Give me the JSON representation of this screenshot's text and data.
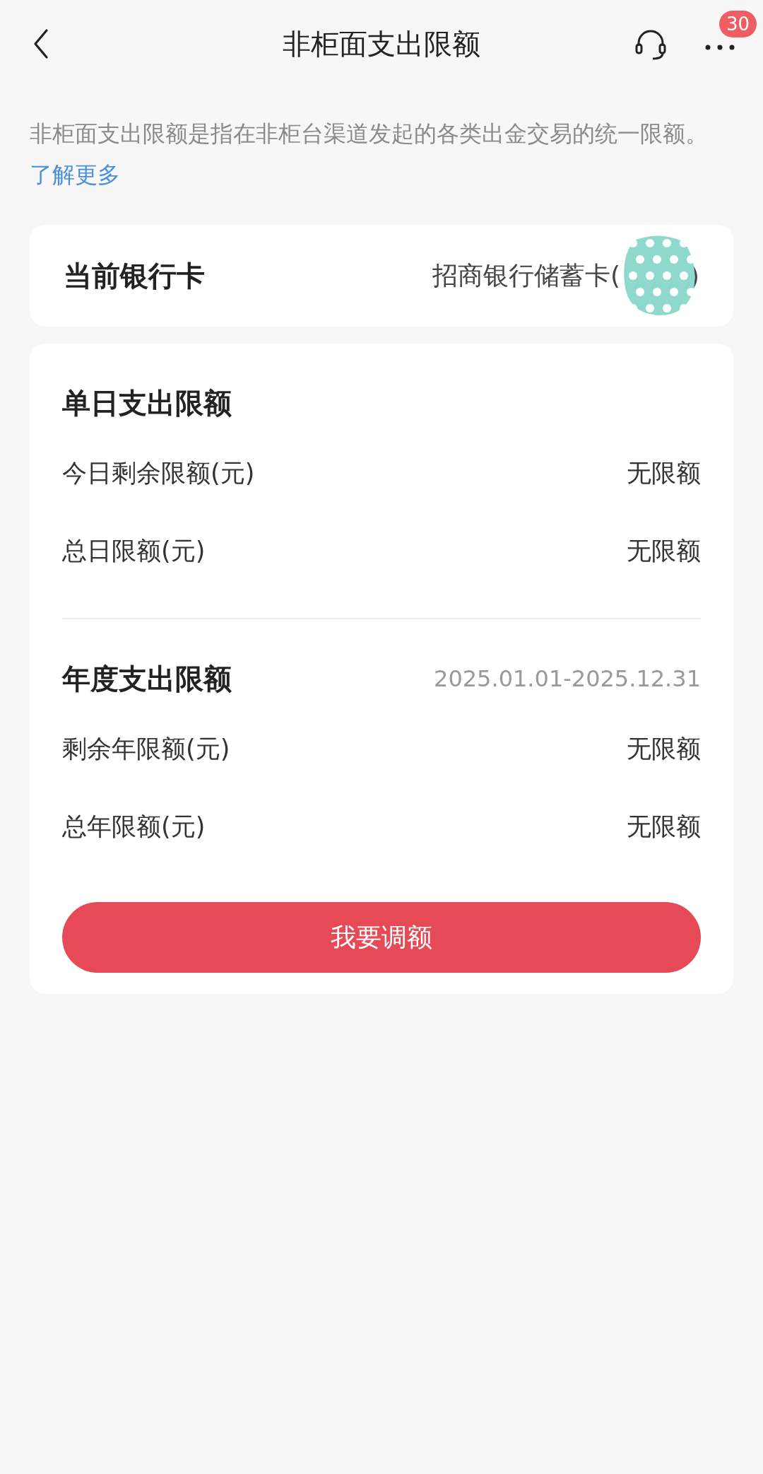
{
  "nav": {
    "title": "非柜面支出限额",
    "badge": "30"
  },
  "intro": {
    "text": "非柜面支出限额是指在非柜台渠道发起的各类出金交易的统一限额。",
    "link": "了解更多"
  },
  "card": {
    "label": "当前银行卡",
    "value": "招商银行储蓄卡(",
    "value_end": ")"
  },
  "sections": [
    {
      "title": "单日支出限额",
      "rows": [
        {
          "label": "今日剩余限额(元)",
          "value": "无限额"
        },
        {
          "label": "总日限额(元)",
          "value": "无限额"
        }
      ]
    },
    {
      "title": "年度支出限额",
      "period": "2025.01.01-2025.12.31",
      "rows": [
        {
          "label": "剩余年限额(元)",
          "value": "无限额"
        },
        {
          "label": "总年限额(元)",
          "value": "无限额"
        }
      ]
    }
  ],
  "button": "我要调额"
}
